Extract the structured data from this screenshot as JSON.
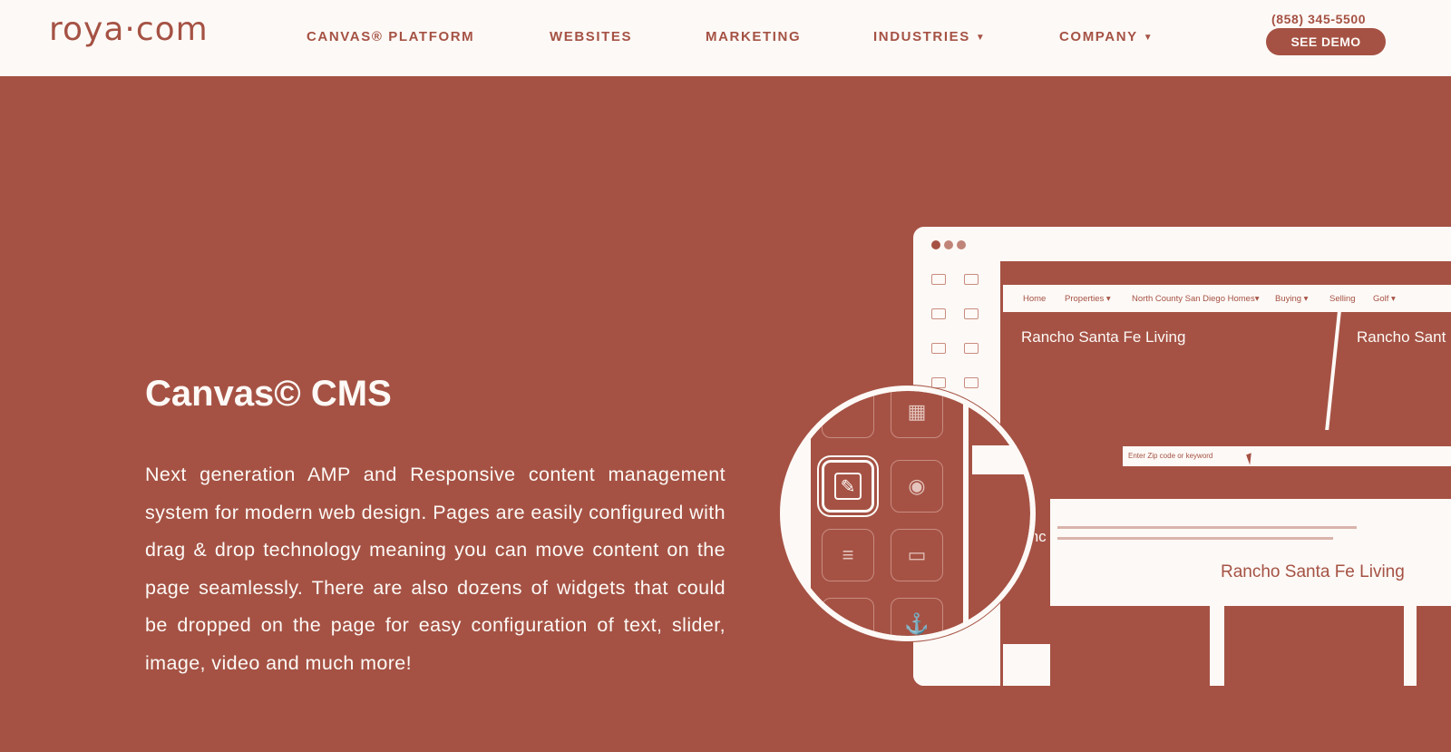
{
  "header": {
    "logo": "roya·com",
    "nav": [
      {
        "label": "CANVAS® PLATFORM",
        "dropdown": false
      },
      {
        "label": "WEBSITES",
        "dropdown": false
      },
      {
        "label": "MARKETING",
        "dropdown": false
      },
      {
        "label": "INDUSTRIES",
        "dropdown": true
      },
      {
        "label": "COMPANY",
        "dropdown": true
      }
    ],
    "phone": "(858) 345-5500",
    "cta": "SEE DEMO",
    "caret": "▼"
  },
  "hero": {
    "title": "Canvas© CMS",
    "description": "Next generation AMP and Responsive content management system for modern web design. Pages are easily configured with drag & drop technology meaning you can move content on the page seamlessly. There are also dozens of widgets that could be dropped on the page for easy configuration of text, slider, image, video and much more!"
  },
  "mockup": {
    "nav": [
      "Home",
      "Properties ▾",
      "North County San Diego Homes▾",
      "Buying ▾",
      "Selling",
      "Golf ▾"
    ],
    "hero_title_left": "Rancho Santa Fe Living",
    "hero_title_right": "Rancho Sant",
    "search_placeholder": "Enter Zip code or keyword",
    "left_snippet": "Ranc",
    "section_title": "Rancho Santa Fe Living"
  },
  "colors": {
    "brand": "#a55244",
    "background_light": "#fdf9f6"
  }
}
